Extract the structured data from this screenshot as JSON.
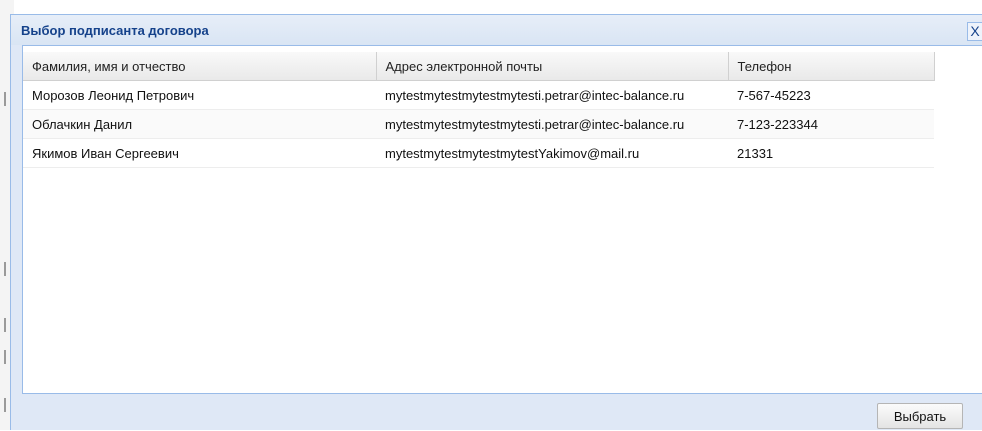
{
  "dialog": {
    "title": "Выбор подписанта договора",
    "close_glyph": "X"
  },
  "grid": {
    "columns": [
      "Фамилия, имя и отчество",
      "Адрес электронной почты",
      "Телефон"
    ],
    "rows": [
      {
        "name": "Морозов Леонид Петрович",
        "email": "mytestmytestmytestmytesti.petrar@intec-balance.ru",
        "phone": "7-567-45223"
      },
      {
        "name": "Облачкин Данил",
        "email": "mytestmytestmytestmytesti.petrar@intec-balance.ru",
        "phone": "7-123-223344"
      },
      {
        "name": "Якимов Иван Сергеевич",
        "email": "mytestmytestmytestmytestYakimov@mail.ru",
        "phone": "21331"
      }
    ]
  },
  "footer": {
    "select_label": "Выбрать"
  }
}
